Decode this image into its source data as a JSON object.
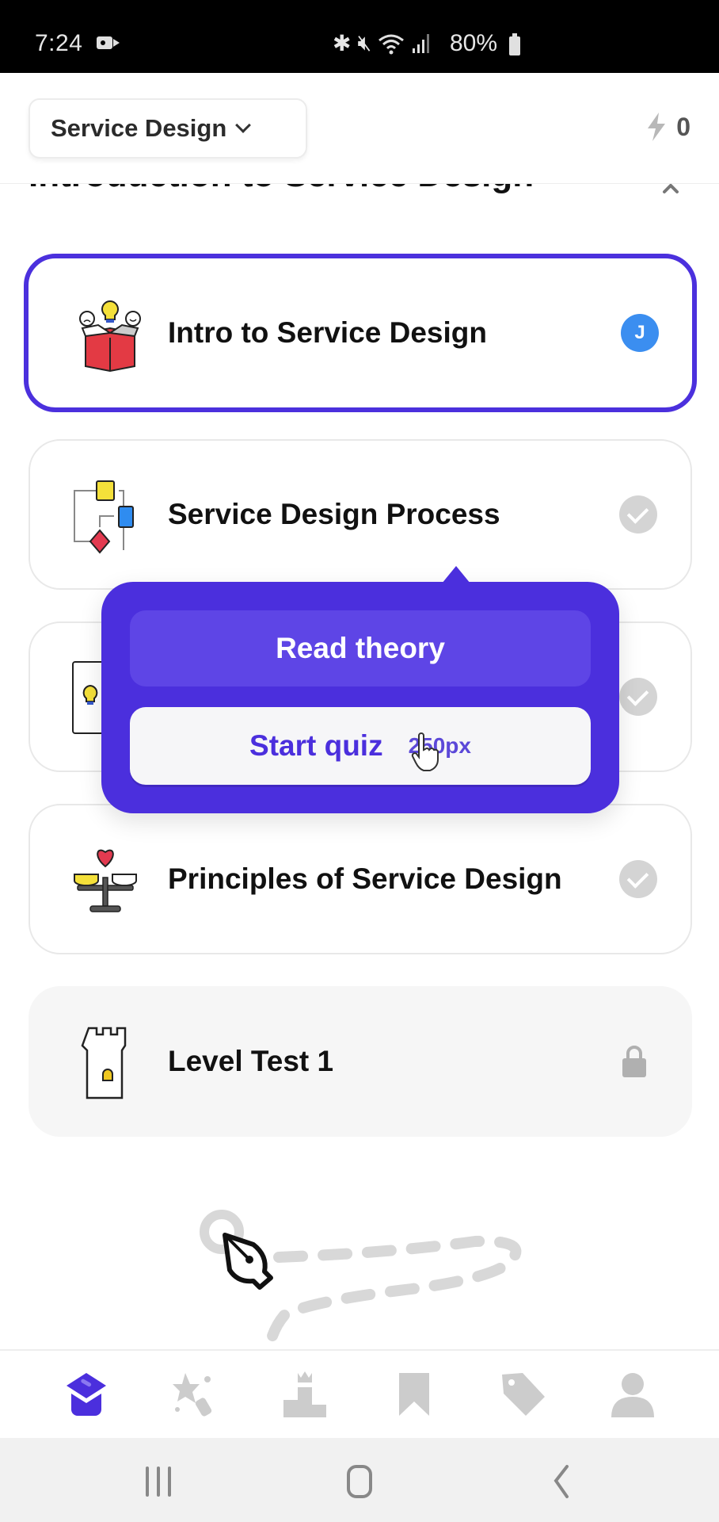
{
  "status_bar": {
    "time": "7:24",
    "battery": "80%",
    "icons": [
      "video-record-icon",
      "bluetooth-icon",
      "mute-icon",
      "wifi-icon",
      "signal-icon",
      "battery-icon"
    ]
  },
  "header": {
    "course_selector": "Service Design",
    "energy_count": "0"
  },
  "section": {
    "title": "Introduction to Service Design"
  },
  "lessons": [
    {
      "title": "Intro to Service Design",
      "status": "in-progress",
      "avatar_letter": "J",
      "icon": "idea-box-icon"
    },
    {
      "title": "Service Design Process",
      "status": "completed",
      "icon": "flowchart-icon"
    },
    {
      "title": "",
      "status": "completed",
      "icon": "lightbulb-card-icon"
    },
    {
      "title": "Principles of Service Design",
      "status": "completed",
      "icon": "balance-scale-heart-icon"
    },
    {
      "title": "Level Test 1",
      "status": "locked",
      "icon": "castle-tower-icon"
    }
  ],
  "popup": {
    "read_theory": "Read theory",
    "start_quiz": "Start quiz",
    "quiz_reward": "250px"
  },
  "bottom_nav": [
    {
      "name": "learn",
      "icon": "graduation-cap-icon",
      "active": true
    },
    {
      "name": "practice",
      "icon": "star-magic-icon",
      "active": false
    },
    {
      "name": "leaderboard",
      "icon": "podium-icon",
      "active": false
    },
    {
      "name": "saved",
      "icon": "bookmark-icon",
      "active": false
    },
    {
      "name": "offers",
      "icon": "tag-icon",
      "active": false
    },
    {
      "name": "profile",
      "icon": "user-icon",
      "active": false
    }
  ],
  "colors": {
    "accent": "#4b2fdd",
    "accent_light": "#5e45e6",
    "avatar": "#3b8ef0",
    "inactive_icon": "#cccccc"
  }
}
